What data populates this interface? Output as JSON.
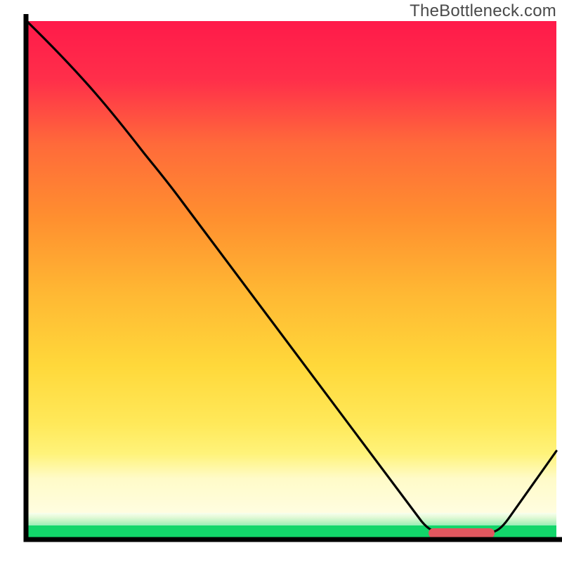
{
  "watermark": "TheBottleneck.com",
  "colors": {
    "gradient_top": "#ff1a4a",
    "gradient_mid": "#ffd83a",
    "gradient_bottom_green": "#12d66a",
    "curve": "#000000",
    "optimal_marker": "#e0575f",
    "axes": "#000000"
  },
  "chart_data": {
    "type": "line",
    "title": "",
    "xlabel": "",
    "ylabel": "",
    "xlim": [
      0,
      100
    ],
    "ylim": [
      0,
      100
    ],
    "grid": false,
    "legend": false,
    "note": "Axis values are unlabeled in the source image; x and y are normalized 0–100 estimates read from pixel positions.",
    "series": [
      {
        "name": "bottleneck-curve",
        "x": [
          0,
          5,
          12,
          22,
          30,
          40,
          50,
          60,
          70,
          75,
          80,
          85,
          88,
          92,
          100
        ],
        "y": [
          100,
          92,
          84,
          74,
          66,
          53,
          40,
          27,
          13,
          5,
          1,
          1,
          1,
          8,
          17
        ]
      }
    ],
    "annotations": [
      {
        "name": "optimal-range-marker",
        "shape": "bar",
        "x_start": 76,
        "x_end": 88,
        "y": 1,
        "color": "#e0575f"
      }
    ],
    "background": {
      "description": "vertical heat gradient red→orange→yellow→green indicating bottleneck severity (red=bad, green=good)"
    }
  }
}
